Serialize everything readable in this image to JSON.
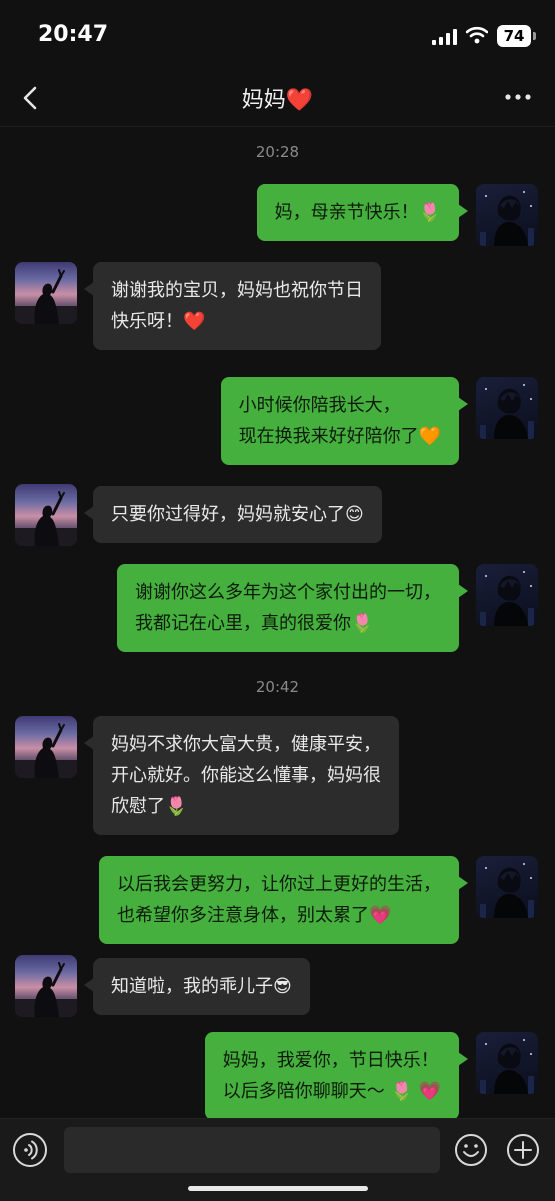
{
  "status": {
    "time": "20:47",
    "battery": "74"
  },
  "header": {
    "title": "妈妈❤️"
  },
  "chat": {
    "time1": "20:28",
    "time2": "20:42",
    "messages": [
      {
        "from": "me",
        "lines": [
          "妈，母亲节快乐！🌷"
        ]
      },
      {
        "from": "mom",
        "lines": [
          "谢谢我的宝贝，妈妈也祝你节日",
          "快乐呀！❤️"
        ]
      },
      {
        "from": "me",
        "lines": [
          "小时候你陪我长大，",
          "现在换我来好好陪你了🧡"
        ]
      },
      {
        "from": "mom",
        "lines": [
          "只要你过得好，妈妈就安心了😊"
        ]
      },
      {
        "from": "me",
        "lines": [
          "谢谢你这么多年为这个家付出的一切，",
          "我都记在心里，真的很爱你🌷"
        ]
      },
      {
        "from": "mom",
        "lines": [
          "妈妈不求你大富大贵，健康平安，",
          "开心就好。你能这么懂事，妈妈很",
          "欣慰了🌷"
        ]
      },
      {
        "from": "me",
        "lines": [
          "以后我会更努力，让你过上更好的生活，",
          "也希望你多注意身体，别太累了💗"
        ]
      },
      {
        "from": "mom",
        "lines": [
          "知道啦，我的乖儿子😎"
        ]
      },
      {
        "from": "me",
        "lines": [
          "妈妈，我爱你，节日快乐！",
          "以后多陪你聊聊天～ 🌷 💗"
        ]
      }
    ]
  },
  "input": {
    "placeholder": ""
  },
  "icons": {
    "voice": "voice-icon",
    "emoji": "emoji-icon",
    "plus": "plus-icon",
    "back": "back-chevron-icon",
    "more": "more-icon"
  },
  "colors": {
    "my_bubble": "#45b03e",
    "their_bubble": "#2c2c2c",
    "background": "#111111"
  }
}
